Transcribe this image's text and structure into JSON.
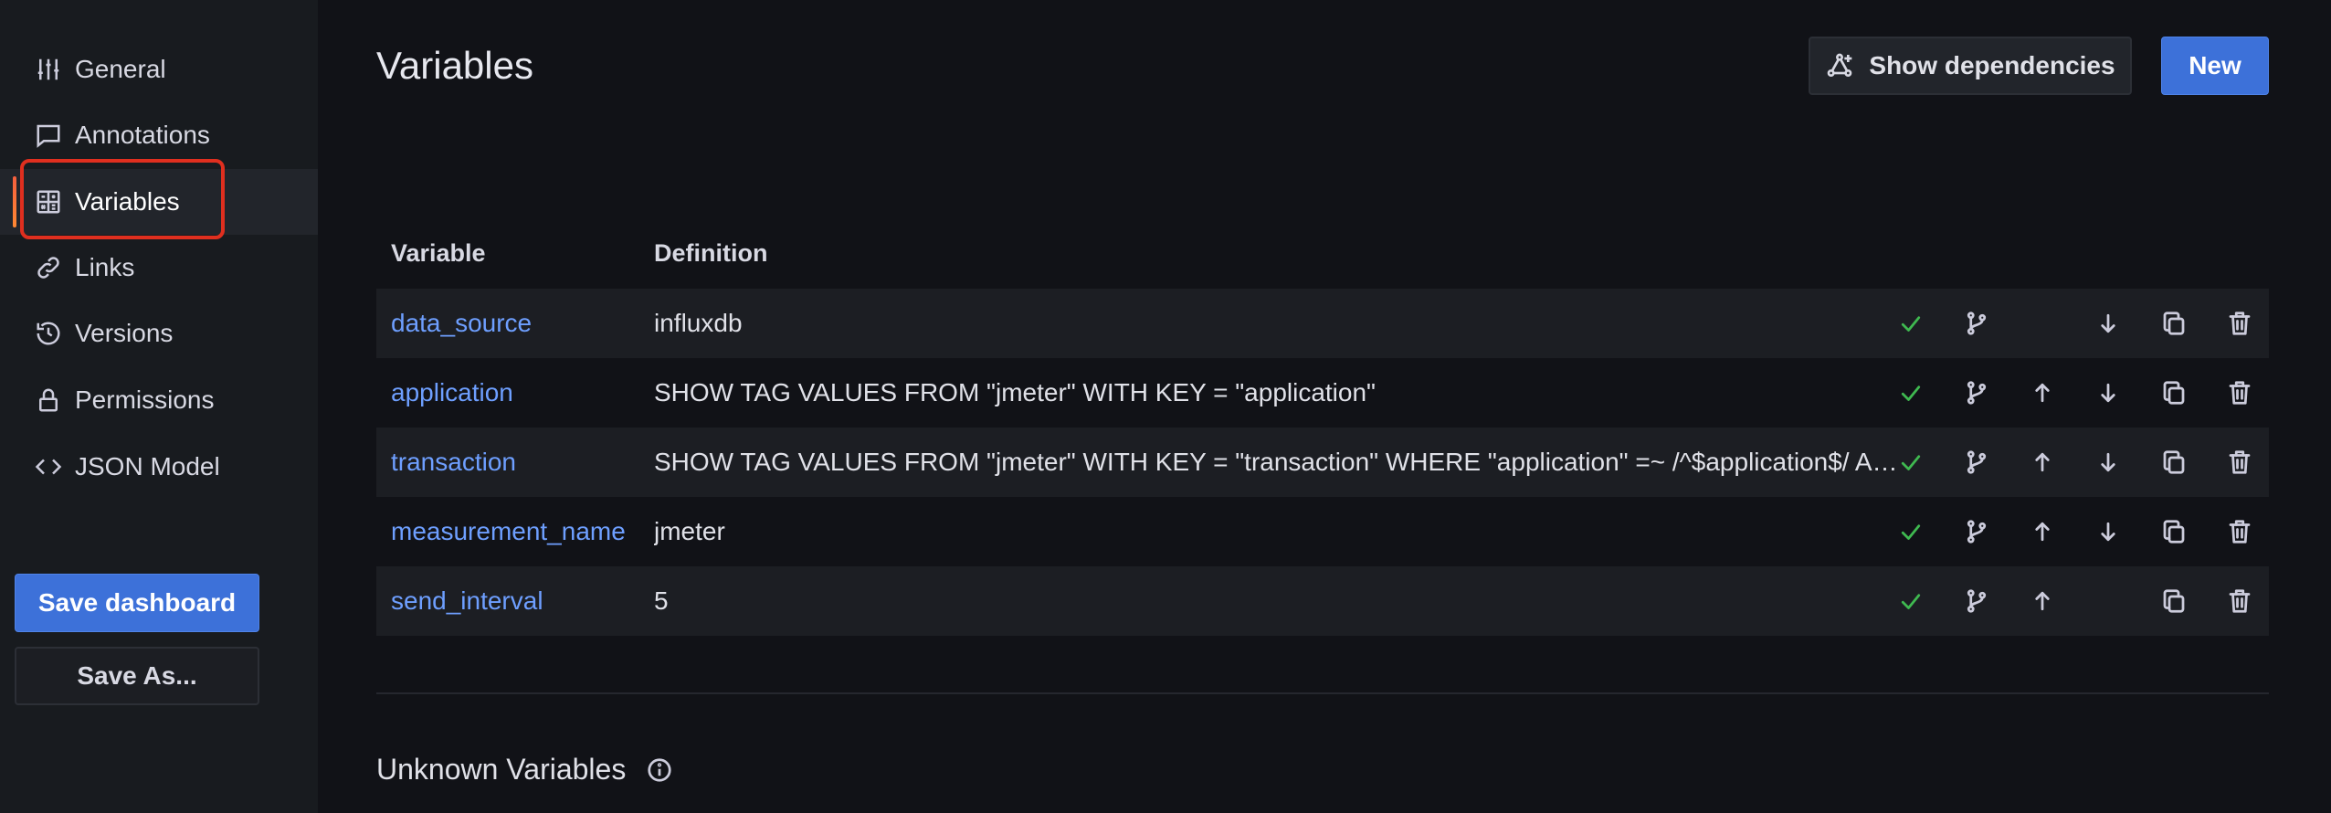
{
  "sidebar": {
    "items": [
      {
        "label": "General",
        "icon": "sliders-icon"
      },
      {
        "label": "Annotations",
        "icon": "comment-icon"
      },
      {
        "label": "Variables",
        "icon": "calculator-icon",
        "active": true
      },
      {
        "label": "Links",
        "icon": "link-icon"
      },
      {
        "label": "Versions",
        "icon": "history-icon"
      },
      {
        "label": "Permissions",
        "icon": "lock-icon"
      },
      {
        "label": "JSON Model",
        "icon": "code-icon"
      }
    ],
    "save_label": "Save dashboard",
    "save_as_label": "Save As..."
  },
  "main": {
    "title": "Variables",
    "show_dependencies_label": "Show dependencies",
    "new_label": "New",
    "columns": {
      "variable": "Variable",
      "definition": "Definition"
    },
    "rows": [
      {
        "name": "data_source",
        "definition": "influxdb"
      },
      {
        "name": "application",
        "definition": "SHOW TAG VALUES FROM \"jmeter\" WITH KEY = \"application\""
      },
      {
        "name": "transaction",
        "definition": "SHOW TAG VALUES FROM \"jmeter\" WITH KEY = \"transaction\" WHERE \"application\" =~ /^$application$/ A…"
      },
      {
        "name": "measurement_name",
        "definition": "jmeter"
      },
      {
        "name": "send_interval",
        "definition": "5"
      }
    ],
    "unknown_title": "Unknown Variables"
  },
  "colors": {
    "accent": "#3d71d9",
    "link": "#6e9fff",
    "success": "#3fb950",
    "highlight": "#e02f1f"
  }
}
